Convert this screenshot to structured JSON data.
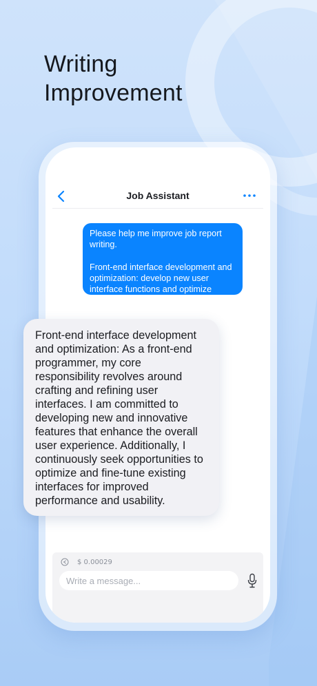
{
  "promo": {
    "headline_line1": "Writing",
    "headline_line2": "Improvement"
  },
  "chat_header": {
    "title": "Job Assistant",
    "back_icon": "chevron-left-icon",
    "more_icon": "more-dots-icon"
  },
  "messages": {
    "user": {
      "line1": "Please help me improve job report writing.",
      "line2": "Front-end interface development and optimization: develop new user interface functions and optimize existing interfaces."
    },
    "assistant": {
      "text": "Front-end interface development and optimization: As a front-end programmer, my core responsibility revolves around crafting and refining user interfaces. I am committed to developing new and innovative features that enhance the overall user experience. Additionally, I continuously seek opportunities to optimize and fine-tune existing interfaces for improved performance and usability."
    }
  },
  "composer": {
    "cost": "$ 0.00029",
    "placeholder": "Write a message...",
    "mic_icon": "microphone-icon",
    "cost_icon": "cost-icon"
  },
  "colors": {
    "accent": "#0a84ff",
    "user_bubble": "#0a84ff",
    "assistant_bubble": "#f1f1f5",
    "background": "#c2dcfb"
  }
}
